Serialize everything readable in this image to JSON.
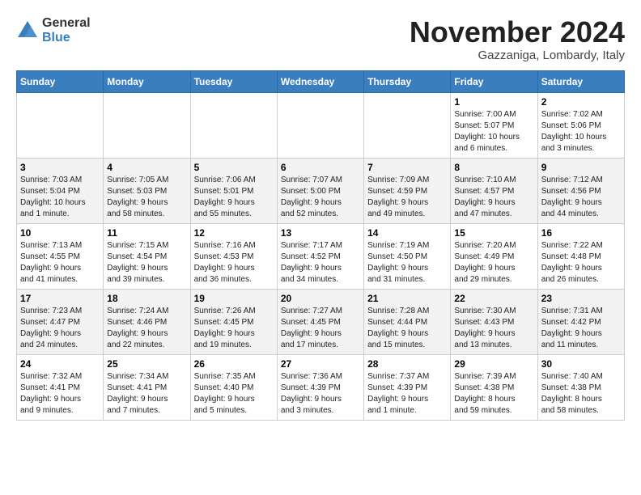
{
  "header": {
    "logo_general": "General",
    "logo_blue": "Blue",
    "title": "November 2024",
    "location": "Gazzaniga, Lombardy, Italy"
  },
  "columns": [
    "Sunday",
    "Monday",
    "Tuesday",
    "Wednesday",
    "Thursday",
    "Friday",
    "Saturday"
  ],
  "weeks": [
    [
      {
        "day": "",
        "info": ""
      },
      {
        "day": "",
        "info": ""
      },
      {
        "day": "",
        "info": ""
      },
      {
        "day": "",
        "info": ""
      },
      {
        "day": "",
        "info": ""
      },
      {
        "day": "1",
        "info": "Sunrise: 7:00 AM\nSunset: 5:07 PM\nDaylight: 10 hours\nand 6 minutes."
      },
      {
        "day": "2",
        "info": "Sunrise: 7:02 AM\nSunset: 5:06 PM\nDaylight: 10 hours\nand 3 minutes."
      }
    ],
    [
      {
        "day": "3",
        "info": "Sunrise: 7:03 AM\nSunset: 5:04 PM\nDaylight: 10 hours\nand 1 minute."
      },
      {
        "day": "4",
        "info": "Sunrise: 7:05 AM\nSunset: 5:03 PM\nDaylight: 9 hours\nand 58 minutes."
      },
      {
        "day": "5",
        "info": "Sunrise: 7:06 AM\nSunset: 5:01 PM\nDaylight: 9 hours\nand 55 minutes."
      },
      {
        "day": "6",
        "info": "Sunrise: 7:07 AM\nSunset: 5:00 PM\nDaylight: 9 hours\nand 52 minutes."
      },
      {
        "day": "7",
        "info": "Sunrise: 7:09 AM\nSunset: 4:59 PM\nDaylight: 9 hours\nand 49 minutes."
      },
      {
        "day": "8",
        "info": "Sunrise: 7:10 AM\nSunset: 4:57 PM\nDaylight: 9 hours\nand 47 minutes."
      },
      {
        "day": "9",
        "info": "Sunrise: 7:12 AM\nSunset: 4:56 PM\nDaylight: 9 hours\nand 44 minutes."
      }
    ],
    [
      {
        "day": "10",
        "info": "Sunrise: 7:13 AM\nSunset: 4:55 PM\nDaylight: 9 hours\nand 41 minutes."
      },
      {
        "day": "11",
        "info": "Sunrise: 7:15 AM\nSunset: 4:54 PM\nDaylight: 9 hours\nand 39 minutes."
      },
      {
        "day": "12",
        "info": "Sunrise: 7:16 AM\nSunset: 4:53 PM\nDaylight: 9 hours\nand 36 minutes."
      },
      {
        "day": "13",
        "info": "Sunrise: 7:17 AM\nSunset: 4:52 PM\nDaylight: 9 hours\nand 34 minutes."
      },
      {
        "day": "14",
        "info": "Sunrise: 7:19 AM\nSunset: 4:50 PM\nDaylight: 9 hours\nand 31 minutes."
      },
      {
        "day": "15",
        "info": "Sunrise: 7:20 AM\nSunset: 4:49 PM\nDaylight: 9 hours\nand 29 minutes."
      },
      {
        "day": "16",
        "info": "Sunrise: 7:22 AM\nSunset: 4:48 PM\nDaylight: 9 hours\nand 26 minutes."
      }
    ],
    [
      {
        "day": "17",
        "info": "Sunrise: 7:23 AM\nSunset: 4:47 PM\nDaylight: 9 hours\nand 24 minutes."
      },
      {
        "day": "18",
        "info": "Sunrise: 7:24 AM\nSunset: 4:46 PM\nDaylight: 9 hours\nand 22 minutes."
      },
      {
        "day": "19",
        "info": "Sunrise: 7:26 AM\nSunset: 4:45 PM\nDaylight: 9 hours\nand 19 minutes."
      },
      {
        "day": "20",
        "info": "Sunrise: 7:27 AM\nSunset: 4:45 PM\nDaylight: 9 hours\nand 17 minutes."
      },
      {
        "day": "21",
        "info": "Sunrise: 7:28 AM\nSunset: 4:44 PM\nDaylight: 9 hours\nand 15 minutes."
      },
      {
        "day": "22",
        "info": "Sunrise: 7:30 AM\nSunset: 4:43 PM\nDaylight: 9 hours\nand 13 minutes."
      },
      {
        "day": "23",
        "info": "Sunrise: 7:31 AM\nSunset: 4:42 PM\nDaylight: 9 hours\nand 11 minutes."
      }
    ],
    [
      {
        "day": "24",
        "info": "Sunrise: 7:32 AM\nSunset: 4:41 PM\nDaylight: 9 hours\nand 9 minutes."
      },
      {
        "day": "25",
        "info": "Sunrise: 7:34 AM\nSunset: 4:41 PM\nDaylight: 9 hours\nand 7 minutes."
      },
      {
        "day": "26",
        "info": "Sunrise: 7:35 AM\nSunset: 4:40 PM\nDaylight: 9 hours\nand 5 minutes."
      },
      {
        "day": "27",
        "info": "Sunrise: 7:36 AM\nSunset: 4:39 PM\nDaylight: 9 hours\nand 3 minutes."
      },
      {
        "day": "28",
        "info": "Sunrise: 7:37 AM\nSunset: 4:39 PM\nDaylight: 9 hours\nand 1 minute."
      },
      {
        "day": "29",
        "info": "Sunrise: 7:39 AM\nSunset: 4:38 PM\nDaylight: 8 hours\nand 59 minutes."
      },
      {
        "day": "30",
        "info": "Sunrise: 7:40 AM\nSunset: 4:38 PM\nDaylight: 8 hours\nand 58 minutes."
      }
    ]
  ]
}
